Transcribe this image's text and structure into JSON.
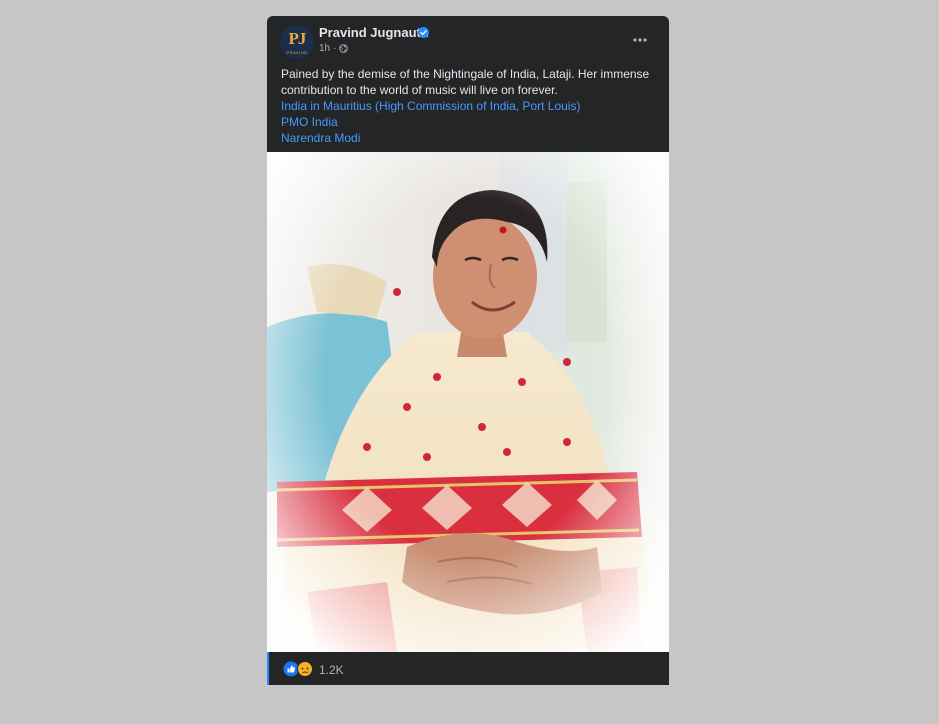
{
  "post": {
    "author": "Pravind Jugnauth",
    "avatar_initials": "PJ",
    "avatar_subtext": "PRAVIND",
    "timestamp": "1h",
    "separator": "·",
    "privacy_icon": "globe-icon",
    "verified_icon": "verified-badge-icon",
    "more_icon": "more-options-icon",
    "text_lines": [
      "Pained by the demise of the Nightingale of India, Lataji. Her immense",
      "contribution to the world of music will live on forever."
    ],
    "tags": [
      "India in Mauritius (High Commission of India, Port Louis)",
      "PMO India",
      "Narendra Modi"
    ],
    "reactions": [
      "like-reaction-icon",
      "sad-reaction-icon"
    ],
    "reaction_count": "1.2K"
  },
  "colors": {
    "card_bg": "#242526",
    "page_bg": "#c6c6c6",
    "link": "#4599ff",
    "verified": "#2d88ff",
    "like": "#1877f2",
    "sad": "#f7b125"
  }
}
